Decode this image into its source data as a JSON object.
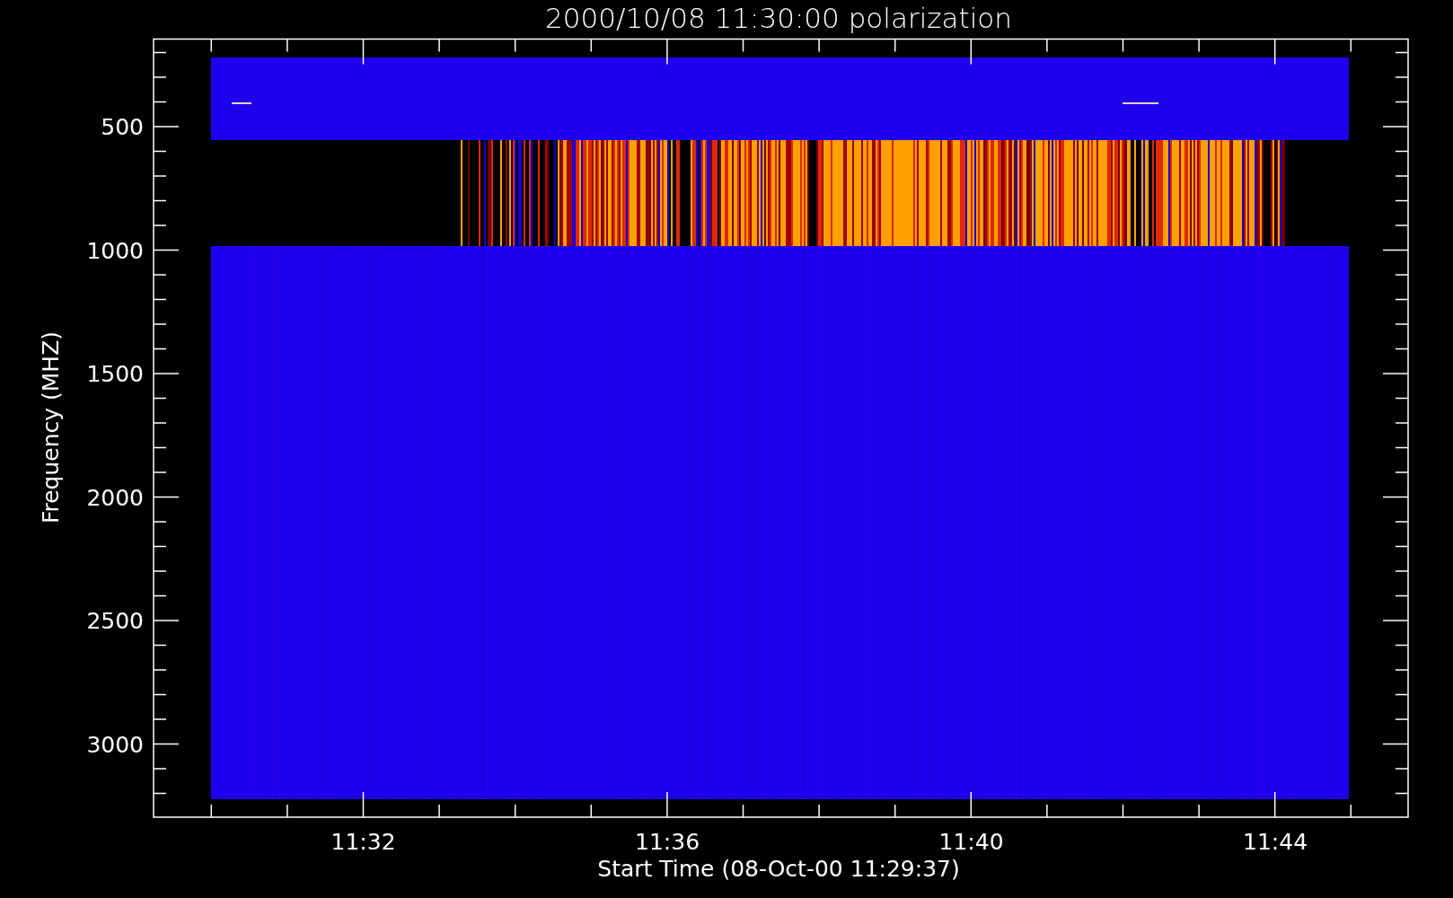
{
  "title": "2000/10/08 11:30:00 polarization",
  "y_axis": {
    "label": "Frequency (MHZ)",
    "ticks": [
      "500",
      "1000",
      "1500",
      "2000",
      "2500",
      "3000"
    ]
  },
  "x_axis": {
    "label": "Start Time (08-Oct-00 11:29:37)",
    "ticks": [
      "11:32",
      "11:36",
      "11:40",
      "11:44"
    ]
  }
}
